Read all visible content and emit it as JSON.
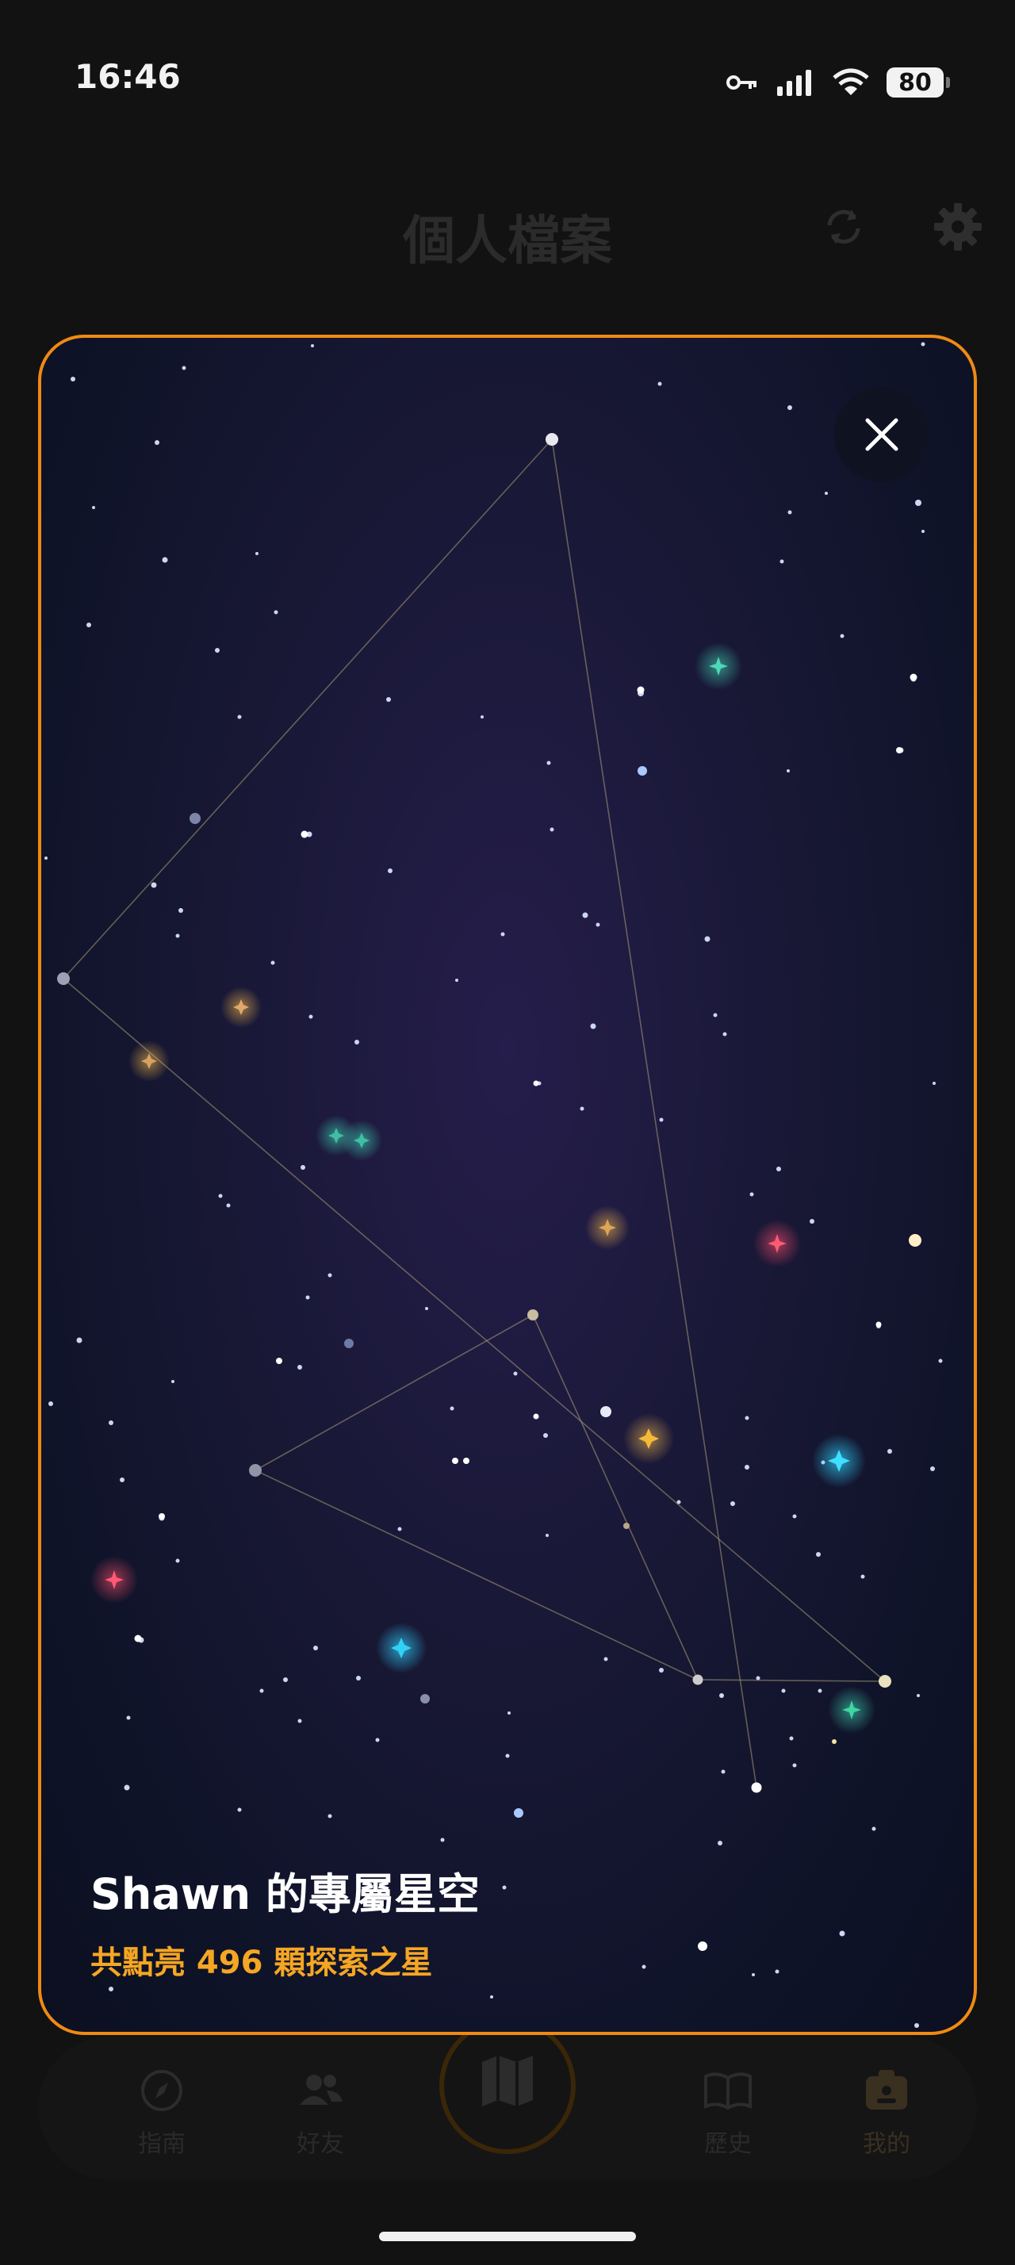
{
  "status_bar": {
    "time": "16:46",
    "battery": "80"
  },
  "header": {
    "title": "個人檔案",
    "sync_icon": "sync-icon",
    "settings_icon": "gear-icon"
  },
  "star_sky": {
    "title": "Shawn 的專屬星空",
    "subtitle": "共點亮 496 顆探索之星",
    "close_icon": "close-icon"
  },
  "bottom_nav": {
    "items": [
      {
        "label": "指南",
        "icon": "compass-icon"
      },
      {
        "label": "好友",
        "icon": "friends-icon"
      },
      {
        "label": "",
        "icon": "map-icon"
      },
      {
        "label": "歷史",
        "icon": "book-icon"
      },
      {
        "label": "我的",
        "icon": "profile-icon"
      }
    ]
  },
  "colors": {
    "accent": "#f08a12",
    "subtitle": "#f5a623",
    "sky_dark": "#10142a",
    "sky_center": "#251d4b"
  }
}
